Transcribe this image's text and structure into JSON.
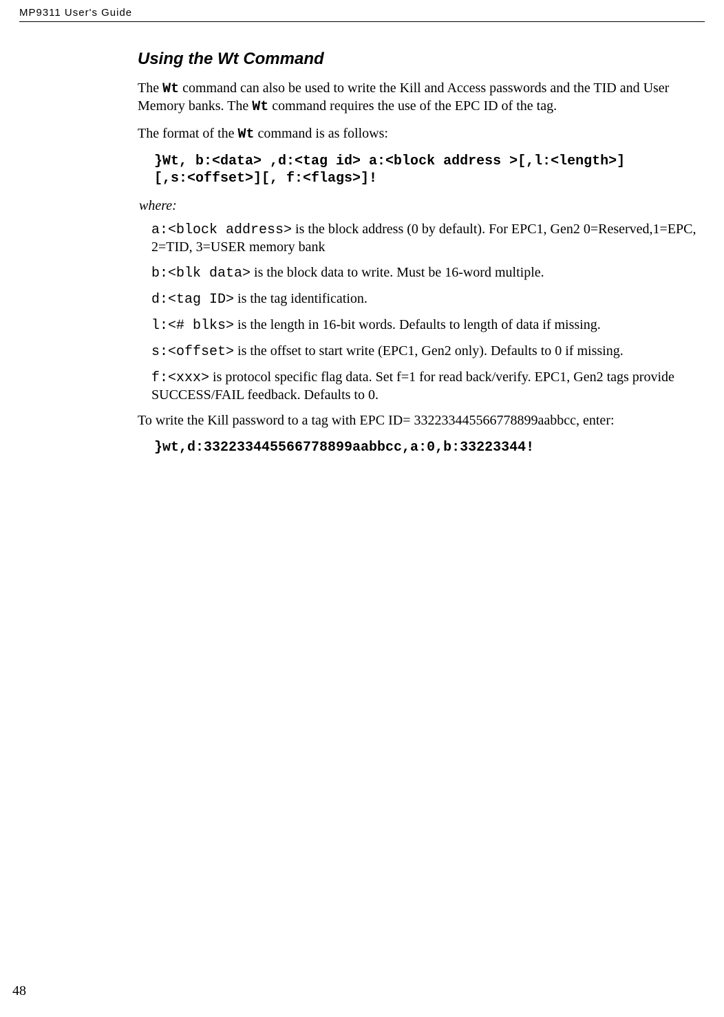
{
  "header": {
    "doc_title": "MP9311 User's Guide"
  },
  "section": {
    "title": "Using the Wt Command"
  },
  "para1": {
    "t1": "The ",
    "wt": "Wt",
    "t2": " command can also be used to write the Kill and Access passwords and the TID and User Memory banks. The ",
    "wt2": "Wt",
    "t3": " command requires the use of the EPC ID of the tag."
  },
  "para2": {
    "t1": "The format of the ",
    "wt": "Wt",
    "t2": " command is as follows:"
  },
  "code1_line1": "}Wt, b:<data> ,d:<tag id> a:<block address >[,l:<length>]",
  "code1_line2": "[,s:<offset>][, f:<flags>]!",
  "where_label": "where:",
  "params": {
    "a": {
      "code": "a:<block address>",
      "desc": "  is the block address (0 by default). For EPC1, Gen2 0=Reserved,1=EPC, 2=TID, 3=USER memory bank"
    },
    "b": {
      "code": "b:<blk data>",
      "desc": " is the block data to write. Must be 16-word multiple."
    },
    "d": {
      "code": "d:<tag ID>",
      "desc": " is the tag identification."
    },
    "l": {
      "code": "l:<# blks>",
      "desc": " is the length in 16-bit words. Defaults to length of data if missing."
    },
    "s": {
      "code": "s:<offset>",
      "desc": " is the offset to start write (EPC1, Gen2 only). Defaults  to 0 if missing."
    },
    "f": {
      "code": "f:<xxx>",
      "desc": " is protocol specific flag data. Set f=1 for read back/verify. EPC1, Gen2 tags provide SUCCESS/FAIL feedback. Defaults to 0."
    }
  },
  "para3": "To write the Kill password to a tag with EPC ID= 332233445566778899aabbcc, enter:",
  "code2": "}wt,d:332233445566778899aabbcc,a:0,b:33223344!",
  "page_number": "48"
}
